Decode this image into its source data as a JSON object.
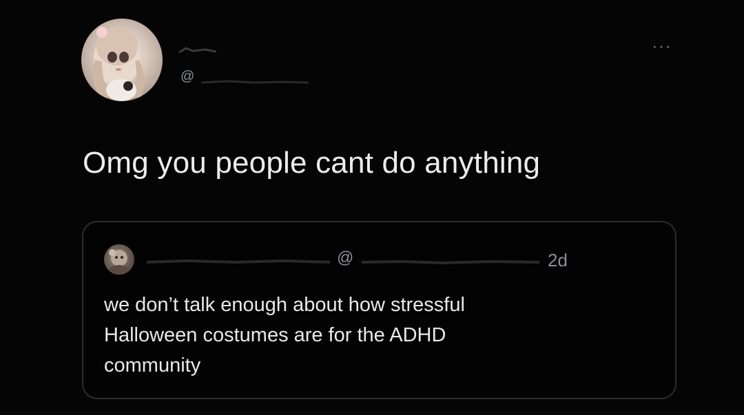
{
  "author": {
    "display_name": "",
    "handle_prefix": "@"
  },
  "menu": {
    "more_label": "···"
  },
  "tweet": {
    "text": "Omg you people cant do anything"
  },
  "quoted_tweet": {
    "display_name": "",
    "handle_prefix": "@",
    "time_ago": "2d",
    "text_lines": [
      "we don’t talk enough about how stressful",
      "Halloween costumes are for the ADHD",
      "community"
    ]
  },
  "colors": {
    "background": "#000000",
    "primary_text": "#e7e9ea",
    "secondary_text": "#8b8f94",
    "card_border": "#2b2d30"
  }
}
